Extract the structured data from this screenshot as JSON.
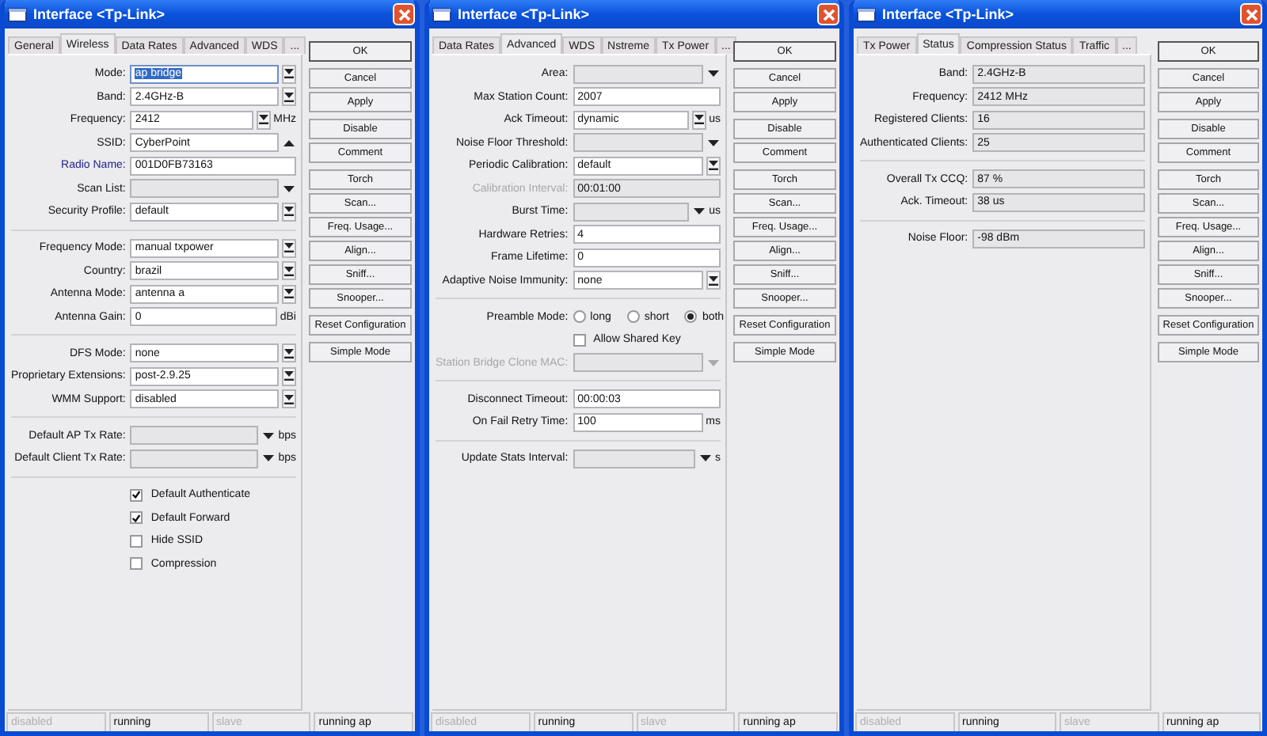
{
  "windows": [
    {
      "title": "Interface <Tp-Link>",
      "tabs": [
        {
          "label": "General",
          "selected": false
        },
        {
          "label": "Wireless",
          "selected": true
        },
        {
          "label": "Data Rates",
          "selected": false
        },
        {
          "label": "Advanced",
          "selected": false
        },
        {
          "label": "WDS",
          "selected": false
        },
        {
          "label": "...",
          "selected": false
        }
      ],
      "groups": [
        [
          {
            "kind": "select",
            "label": "Mode:",
            "value": "ap bridge",
            "focused": true,
            "disabled": false
          },
          {
            "kind": "select",
            "label": "Band:",
            "value": "2.4GHz-B",
            "focused": false,
            "disabled": false
          },
          {
            "kind": "select",
            "label": "Frequency:",
            "value": "2412",
            "unit": "MHz",
            "focused": false,
            "disabled": false
          },
          {
            "kind": "dropdown",
            "label": "SSID:",
            "value": "CyberPoint",
            "expanded": true,
            "focused": false,
            "disabled": false
          },
          {
            "kind": "text",
            "label": "Radio Name:",
            "value": "001D0FB73163",
            "color": "#1c1c8c",
            "focused": false,
            "disabled": false
          },
          {
            "kind": "dropdown",
            "label": "Scan List:",
            "expanded": false,
            "focused": false,
            "disabled": false
          },
          {
            "kind": "select",
            "label": "Security Profile:",
            "value": "default",
            "focused": false,
            "disabled": false
          }
        ],
        [
          {
            "kind": "select",
            "label": "Frequency Mode:",
            "value": "manual txpower",
            "focused": false,
            "disabled": false
          },
          {
            "kind": "select",
            "label": "Country:",
            "value": "brazil",
            "focused": false,
            "disabled": false
          },
          {
            "kind": "select",
            "label": "Antenna Mode:",
            "value": "antenna a",
            "focused": false,
            "disabled": false
          },
          {
            "kind": "text",
            "label": "Antenna Gain:",
            "value": "0",
            "unit": "dBi",
            "focused": false,
            "disabled": false
          }
        ],
        [
          {
            "kind": "select",
            "label": "DFS Mode:",
            "value": "none",
            "focused": false,
            "disabled": false
          },
          {
            "kind": "select",
            "label": "Proprietary Extensions:",
            "value": "post-2.9.25",
            "focused": false,
            "disabled": false
          },
          {
            "kind": "select",
            "label": "WMM Support:",
            "value": "disabled",
            "focused": false,
            "disabled": false
          }
        ],
        [
          {
            "kind": "dropdown",
            "label": "Default AP Tx Rate:",
            "expanded": false,
            "unit": "bps",
            "focused": false,
            "disabled": false
          },
          {
            "kind": "dropdown",
            "label": "Default Client Tx Rate:",
            "expanded": false,
            "unit": "bps",
            "focused": false,
            "disabled": false
          }
        ],
        [
          {
            "kind": "checkbox",
            "label": "Default Authenticate",
            "checked": true
          },
          {
            "kind": "checkbox",
            "label": "Default Forward",
            "checked": true
          },
          {
            "kind": "checkbox",
            "label": "Hide SSID",
            "checked": false
          },
          {
            "kind": "checkbox",
            "label": "Compression",
            "checked": false
          }
        ]
      ],
      "buttons": [
        [
          {
            "label": "OK",
            "default": true
          }
        ],
        [
          {
            "label": "Cancel",
            "default": false
          },
          {
            "label": "Apply",
            "default": false
          }
        ],
        [
          {
            "label": "Disable",
            "default": false
          },
          {
            "label": "Comment",
            "default": false
          }
        ],
        [
          {
            "label": "Torch",
            "default": false
          },
          {
            "label": "Scan...",
            "default": false
          },
          {
            "label": "Freq. Usage...",
            "default": false
          },
          {
            "label": "Align...",
            "default": false
          },
          {
            "label": "Sniff...",
            "default": false
          },
          {
            "label": "Snooper...",
            "default": false
          }
        ],
        [
          {
            "label": "Reset Configuration",
            "default": false
          }
        ],
        [
          {
            "label": "Simple Mode",
            "default": false
          }
        ]
      ],
      "status_bar": [
        {
          "text": "disabled",
          "disabled": true
        },
        {
          "text": "running",
          "disabled": false
        },
        {
          "text": "slave",
          "disabled": true
        },
        {
          "text": "running ap",
          "disabled": false
        }
      ]
    },
    {
      "title": "Interface <Tp-Link>",
      "tabs": [
        {
          "label": "Data Rates",
          "selected": false
        },
        {
          "label": "Advanced",
          "selected": true
        },
        {
          "label": "WDS",
          "selected": false
        },
        {
          "label": "Nstreme",
          "selected": false
        },
        {
          "label": "Tx Power",
          "selected": false
        },
        {
          "label": "...",
          "selected": false
        }
      ],
      "groups": [
        [
          {
            "kind": "dropdown",
            "label": "Area:",
            "expanded": false,
            "focused": false,
            "disabled": false
          },
          {
            "kind": "text",
            "label": "Max Station Count:",
            "value": "2007",
            "focused": false,
            "disabled": false
          },
          {
            "kind": "select",
            "label": "Ack Timeout:",
            "value": "dynamic",
            "unit": "us",
            "focused": false,
            "disabled": false
          },
          {
            "kind": "dropdown",
            "label": "Noise Floor Threshold:",
            "expanded": false,
            "focused": false,
            "disabled": false
          },
          {
            "kind": "select",
            "label": "Periodic Calibration:",
            "value": "default",
            "focused": false,
            "disabled": false
          },
          {
            "kind": "readonly",
            "label": "Calibration Interval:",
            "value": "00:01:00",
            "focused": false,
            "disabled": true
          },
          {
            "kind": "dropdown",
            "label": "Burst Time:",
            "expanded": false,
            "unit": "us",
            "focused": false,
            "disabled": false
          },
          {
            "kind": "text",
            "label": "Hardware Retries:",
            "value": "4",
            "focused": false,
            "disabled": false
          },
          {
            "kind": "text",
            "label": "Frame Lifetime:",
            "value": "0",
            "focused": false,
            "disabled": false
          },
          {
            "kind": "select",
            "label": "Adaptive Noise Immunity:",
            "value": "none",
            "focused": false,
            "disabled": false
          }
        ],
        [
          {
            "kind": "radio",
            "label": "Preamble Mode:",
            "options": [
              {
                "label": "long",
                "selected": false
              },
              {
                "label": "short",
                "selected": false
              },
              {
                "label": "both",
                "selected": true
              }
            ]
          },
          {
            "kind": "checkbox",
            "label": "Allow Shared Key",
            "checked": false
          },
          {
            "kind": "dropdown",
            "label": "Station Bridge Clone MAC:",
            "expanded": false,
            "focused": false,
            "disabled": true
          }
        ],
        [
          {
            "kind": "text",
            "label": "Disconnect Timeout:",
            "value": "00:00:03",
            "focused": false,
            "disabled": false
          },
          {
            "kind": "text",
            "label": "On Fail Retry Time:",
            "value": "100",
            "unit": "ms",
            "focused": false,
            "disabled": false
          }
        ],
        [
          {
            "kind": "dropdown",
            "label": "Update Stats Interval:",
            "expanded": false,
            "unit": "s",
            "focused": false,
            "disabled": false
          }
        ]
      ],
      "buttons": [
        [
          {
            "label": "OK",
            "default": true
          }
        ],
        [
          {
            "label": "Cancel",
            "default": false
          },
          {
            "label": "Apply",
            "default": false
          }
        ],
        [
          {
            "label": "Disable",
            "default": false
          },
          {
            "label": "Comment",
            "default": false
          }
        ],
        [
          {
            "label": "Torch",
            "default": false
          },
          {
            "label": "Scan...",
            "default": false
          },
          {
            "label": "Freq. Usage...",
            "default": false
          },
          {
            "label": "Align...",
            "default": false
          },
          {
            "label": "Sniff...",
            "default": false
          },
          {
            "label": "Snooper...",
            "default": false
          }
        ],
        [
          {
            "label": "Reset Configuration",
            "default": false
          }
        ],
        [
          {
            "label": "Simple Mode",
            "default": false
          }
        ]
      ],
      "status_bar": [
        {
          "text": "disabled",
          "disabled": true
        },
        {
          "text": "running",
          "disabled": false
        },
        {
          "text": "slave",
          "disabled": true
        },
        {
          "text": "running ap",
          "disabled": false
        }
      ]
    },
    {
      "title": "Interface <Tp-Link>",
      "tabs": [
        {
          "label": "Tx Power",
          "selected": false
        },
        {
          "label": "Status",
          "selected": true
        },
        {
          "label": "Compression Status",
          "selected": false
        },
        {
          "label": "Traffic",
          "selected": false
        },
        {
          "label": "...",
          "selected": false
        }
      ],
      "groups": [
        [
          {
            "kind": "readonly",
            "label": "Band:",
            "value": "2.4GHz-B",
            "focused": false,
            "disabled": false
          },
          {
            "kind": "readonly",
            "label": "Frequency:",
            "value": "2412 MHz",
            "focused": false,
            "disabled": false
          },
          {
            "kind": "readonly",
            "label": "Registered Clients:",
            "value": "16",
            "focused": false,
            "disabled": false
          },
          {
            "kind": "readonly",
            "label": "Authenticated Clients:",
            "value": "25",
            "focused": false,
            "disabled": false
          }
        ],
        [
          {
            "kind": "readonly",
            "label": "Overall Tx CCQ:",
            "value": "87 %",
            "focused": false,
            "disabled": false
          },
          {
            "kind": "readonly",
            "label": "Ack. Timeout:",
            "value": "38 us",
            "focused": false,
            "disabled": false
          }
        ],
        [
          {
            "kind": "readonly",
            "label": "Noise Floor:",
            "value": "-98 dBm",
            "focused": false,
            "disabled": false
          }
        ]
      ],
      "buttons": [
        [
          {
            "label": "OK",
            "default": true
          }
        ],
        [
          {
            "label": "Cancel",
            "default": false
          },
          {
            "label": "Apply",
            "default": false
          }
        ],
        [
          {
            "label": "Disable",
            "default": false
          },
          {
            "label": "Comment",
            "default": false
          }
        ],
        [
          {
            "label": "Torch",
            "default": false
          },
          {
            "label": "Scan...",
            "default": false
          },
          {
            "label": "Freq. Usage...",
            "default": false
          },
          {
            "label": "Align...",
            "default": false
          },
          {
            "label": "Sniff...",
            "default": false
          },
          {
            "label": "Snooper...",
            "default": false
          }
        ],
        [
          {
            "label": "Reset Configuration",
            "default": false
          }
        ],
        [
          {
            "label": "Simple Mode",
            "default": false
          }
        ]
      ],
      "status_bar": [
        {
          "text": "disabled",
          "disabled": true
        },
        {
          "text": "running",
          "disabled": false
        },
        {
          "text": "slave",
          "disabled": true
        },
        {
          "text": "running ap",
          "disabled": false
        }
      ]
    }
  ]
}
